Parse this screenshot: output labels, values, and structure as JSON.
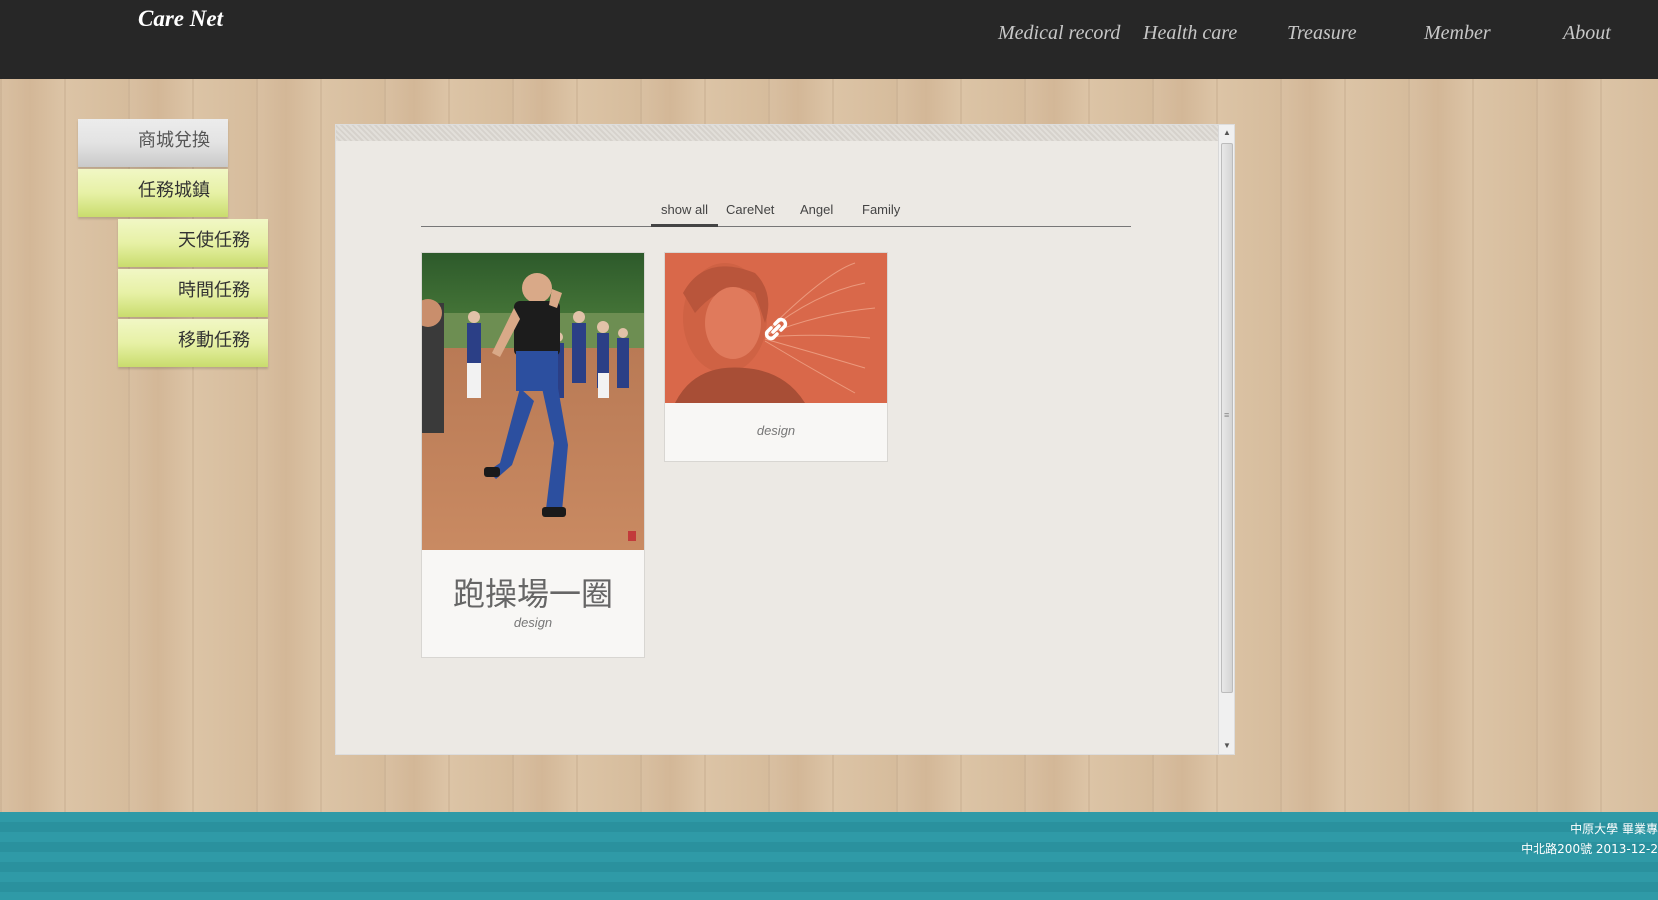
{
  "header": {
    "logo": "Care Net",
    "nav": [
      "Medical record",
      "Health care",
      "Treasure",
      "Member",
      "About"
    ]
  },
  "sidebar": {
    "items": [
      {
        "label": "商城兌換"
      },
      {
        "label": "任務城鎮"
      },
      {
        "label": "天使任務"
      },
      {
        "label": "時間任務"
      },
      {
        "label": "移動任務"
      }
    ]
  },
  "filters": {
    "tabs": [
      "show all",
      "CareNet",
      "Angel",
      "Family"
    ],
    "active": "show all"
  },
  "cards": [
    {
      "title": "跑操場一圈",
      "caption": "design"
    },
    {
      "caption": "design"
    }
  ],
  "footer": {
    "line1": "中原大學 畢業專",
    "line2": "中北路200號 2013-12-2"
  },
  "colors": {
    "header_bg": "#272727",
    "footer_bg": "#2f9aa7",
    "card2_overlay": "#d9684a"
  }
}
